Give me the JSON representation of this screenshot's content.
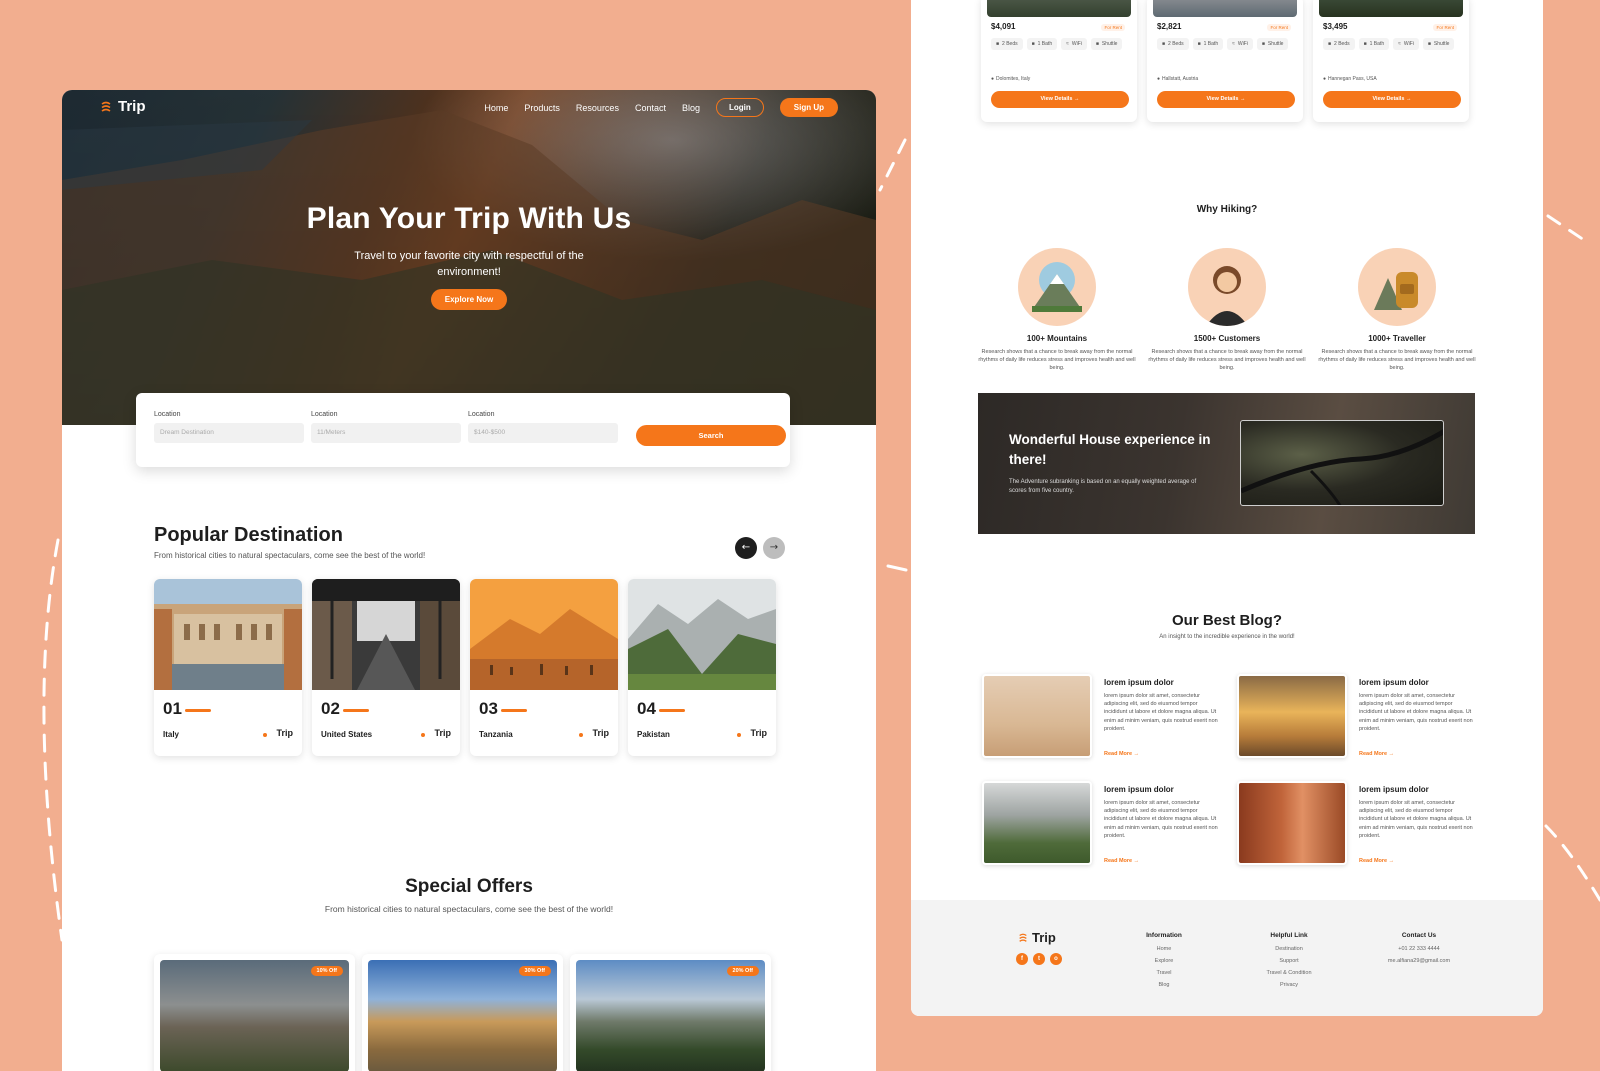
{
  "colors": {
    "accent": "#f5761a",
    "background": "#f2ae8f",
    "dark_button": "#1e1e1e",
    "light_button": "#bdbdbd"
  },
  "left": {
    "brand": "Trip",
    "nav": {
      "links": [
        "Home",
        "Products",
        "Resources",
        "Contact",
        "Blog"
      ],
      "login": "Login",
      "signup": "Sign Up"
    },
    "hero": {
      "title": "Plan Your Trip With Us",
      "subtitle": "Travel to your favorite city with respectful of the environment!",
      "cta": "Explore Now"
    },
    "search": {
      "fields": [
        {
          "label": "Location",
          "placeholder": "Dream Destination"
        },
        {
          "label": "Location",
          "placeholder": "11/Meters"
        },
        {
          "label": "Location",
          "placeholder": "$140-$500"
        }
      ],
      "button": "Search"
    },
    "popular": {
      "title": "Popular Destination",
      "subtitle": "From historical cities to natural spectaculars, come see the best of the world!",
      "prev_icon": "arrow-left-icon",
      "next_icon": "arrow-right-icon",
      "cards": [
        {
          "num": "01",
          "name": "Italy",
          "brand": "Trip"
        },
        {
          "num": "02",
          "name": "United States",
          "brand": "Trip"
        },
        {
          "num": "03",
          "name": "Tanzania",
          "brand": "Trip"
        },
        {
          "num": "04",
          "name": "Pakistan",
          "brand": "Trip"
        }
      ]
    },
    "offers": {
      "title": "Special Offers",
      "subtitle": "From historical cities to natural spectaculars, come see the best of the world!",
      "cards": [
        {
          "badge": "10% Off"
        },
        {
          "badge": "30% Off"
        },
        {
          "badge": "20% Off"
        }
      ]
    }
  },
  "right": {
    "properties": [
      {
        "price": "$4,091",
        "rent": "For Rent",
        "tags": [
          "2 Beds",
          "1 Bath",
          "WiFi",
          "Shuttle"
        ],
        "location": "Dolomites, Italy",
        "button": "View Details"
      },
      {
        "price": "$2,821",
        "rent": "For Rent",
        "tags": [
          "2 Beds",
          "1 Bath",
          "WiFi",
          "Shuttle"
        ],
        "location": "Hallstatt, Austria",
        "button": "View Details"
      },
      {
        "price": "$3,495",
        "rent": "For Rent",
        "tags": [
          "2 Beds",
          "1 Bath",
          "WiFi",
          "Shuttle"
        ],
        "location": "Hannegan Pass, USA",
        "button": "View Details"
      }
    ],
    "why": {
      "title": "Why Hiking?",
      "items": [
        {
          "name": "100+ Mountains",
          "desc": "Research shows that a chance to break away from the normal rhythms of daily life reduces stress and improves health and well being."
        },
        {
          "name": "1500+ Customers",
          "desc": "Research shows that a chance to break away from the normal rhythms of daily life reduces stress and improves health and well being."
        },
        {
          "name": "1000+ Traveller",
          "desc": "Research shows that a chance to break away from the normal rhythms of daily life reduces stress and improves health and well being."
        }
      ]
    },
    "banner": {
      "title": "Wonderful House experience in there!",
      "text": "The Adventure subranking is based on an equally weighted average of scores from five country."
    },
    "blog": {
      "title": "Our Best Blog?",
      "subtitle": "An insight to the incredible experience in the world!",
      "posts": [
        {
          "title": "lorem ipsum dolor",
          "text": "lorem ipsum dolor sit amet, consectetur adipiscing elit, sed do eiusmod tempor incididunt ut labore et dolore magna aliqua. Ut enim ad minim veniam, quis nostrud exerit non proident.",
          "more": "Read More"
        },
        {
          "title": "lorem ipsum dolor",
          "text": "lorem ipsum dolor sit amet, consectetur adipiscing elit, sed do eiusmod tempor incididunt ut labore et dolore magna aliqua. Ut enim ad minim veniam, quis nostrud exerit non proident.",
          "more": "Read More"
        },
        {
          "title": "lorem ipsum dolor",
          "text": "lorem ipsum dolor sit amet, consectetur adipiscing elit, sed do eiusmod tempor incididunt ut labore et dolore magna aliqua. Ut enim ad minim veniam, quis nostrud exerit non proident.",
          "more": "Read More"
        },
        {
          "title": "lorem ipsum dolor",
          "text": "lorem ipsum dolor sit amet, consectetur adipiscing elit, sed do eiusmod tempor incididunt ut labore et dolore magna aliqua. Ut enim ad minim veniam, quis nostrud exerit non proident.",
          "more": "Read More"
        }
      ]
    },
    "footer": {
      "brand": "Trip",
      "social": [
        "f",
        "t",
        "o"
      ],
      "columns": [
        {
          "title": "Information",
          "links": [
            "Home",
            "Explore",
            "Travel",
            "Blog"
          ]
        },
        {
          "title": "Helpful Link",
          "links": [
            "Destination",
            "Support",
            "Travel & Condition",
            "Privacy"
          ]
        },
        {
          "title": "Contact Us",
          "links": [
            "+01 22 333 4444",
            "me.alfiana29@gmail.com"
          ]
        }
      ]
    }
  }
}
